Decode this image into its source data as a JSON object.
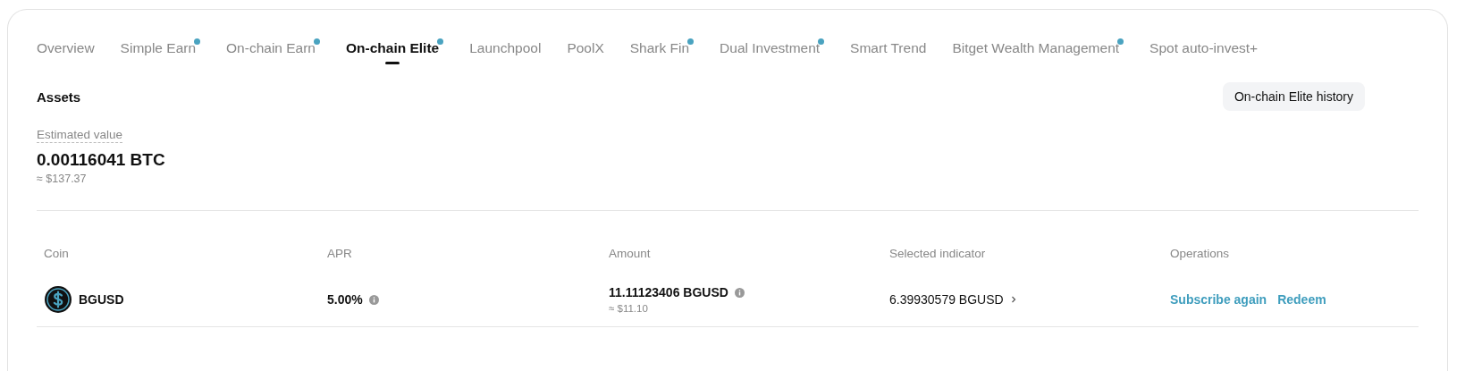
{
  "tabs": [
    {
      "label": "Overview",
      "selected": false,
      "dot": false
    },
    {
      "label": "Simple Earn",
      "selected": false,
      "dot": true
    },
    {
      "label": "On-chain Earn",
      "selected": false,
      "dot": true
    },
    {
      "label": "On-chain Elite",
      "selected": true,
      "dot": true
    },
    {
      "label": "Launchpool",
      "selected": false,
      "dot": false
    },
    {
      "label": "PoolX",
      "selected": false,
      "dot": false
    },
    {
      "label": "Shark Fin",
      "selected": false,
      "dot": true
    },
    {
      "label": "Dual Investment",
      "selected": false,
      "dot": true
    },
    {
      "label": "Smart Trend",
      "selected": false,
      "dot": false
    },
    {
      "label": "Bitget Wealth Management",
      "selected": false,
      "dot": true
    },
    {
      "label": "Spot auto-invest+",
      "selected": false,
      "dot": false
    }
  ],
  "assets": {
    "title": "Assets",
    "history_button": "On-chain Elite history",
    "estimated_label": "Estimated value",
    "value": "0.00116041 BTC",
    "fiat": "≈ $137.37"
  },
  "table": {
    "columns": [
      "Coin",
      "APR",
      "Amount",
      "Selected indicator",
      "Operations"
    ],
    "rows": [
      {
        "coin": "BGUSD",
        "apr": "5.00%",
        "amount": "11.11123406 BGUSD",
        "amount_fiat": "≈ $11.10",
        "indicator": "6.39930579 BGUSD",
        "actions": [
          "Subscribe again",
          "Redeem"
        ]
      }
    ]
  }
}
